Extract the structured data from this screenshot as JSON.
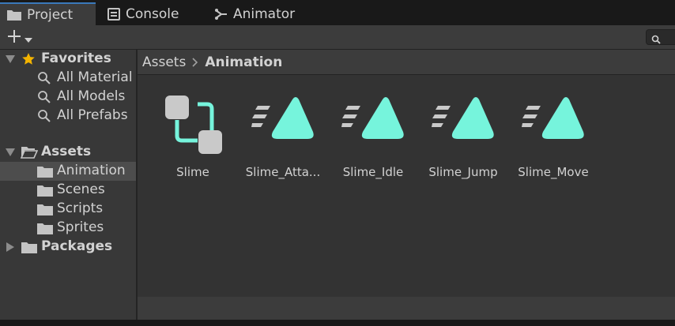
{
  "tabs": [
    {
      "label": "Project",
      "icon": "folder-icon",
      "active": true
    },
    {
      "label": "Console",
      "icon": "console-icon",
      "active": false
    },
    {
      "label": "Animator",
      "icon": "animator-icon",
      "active": false
    }
  ],
  "toolbar": {
    "add_icon": "plus-icon",
    "dropdown_icon": "caret-down-icon",
    "search_icon": "search-icon"
  },
  "tree": {
    "favorites": {
      "label": "Favorites",
      "items": [
        {
          "label": "All Material"
        },
        {
          "label": "All Models"
        },
        {
          "label": "All Prefabs"
        }
      ]
    },
    "assets": {
      "label": "Assets",
      "items": [
        {
          "label": "Animation",
          "selected": true
        },
        {
          "label": "Scenes"
        },
        {
          "label": "Scripts"
        },
        {
          "label": "Sprites"
        }
      ]
    },
    "packages": {
      "label": "Packages"
    }
  },
  "breadcrumb": {
    "root": "Assets",
    "current": "Animation"
  },
  "assets": [
    {
      "name": "Slime",
      "type": "animator-controller"
    },
    {
      "name": "Slime_Atta...",
      "type": "animation-clip"
    },
    {
      "name": "Slime_Idle",
      "type": "animation-clip"
    },
    {
      "name": "Slime_Jump",
      "type": "animation-clip"
    },
    {
      "name": "Slime_Move",
      "type": "animation-clip"
    }
  ],
  "colors": {
    "accent": "#3a79bb",
    "clip": "#76f4dc",
    "favorite": "#f4b400",
    "selection": "#4d4d4d"
  }
}
